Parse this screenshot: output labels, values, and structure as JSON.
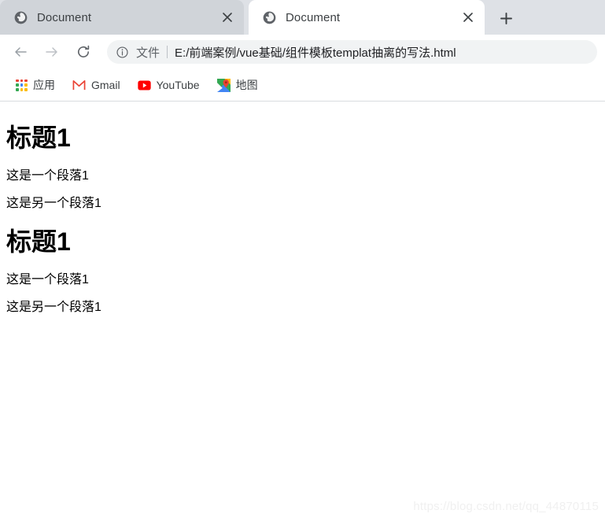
{
  "browser": {
    "tabs": [
      {
        "title": "Document",
        "favicon": "globe-icon",
        "close_label": "×",
        "active": false
      },
      {
        "title": "Document",
        "favicon": "globe-icon",
        "close_label": "×",
        "active": true
      }
    ],
    "new_tab_label": "+",
    "toolbar": {
      "back_label": "←",
      "forward_label": "→",
      "reload_label": "⟳",
      "security_icon": "info-circle-icon",
      "url_scheme": "文件",
      "url_divider": "|",
      "url": "E:/前端案例/vue基础/组件模板templat抽离的写法.html"
    },
    "bookmarks": [
      {
        "label": "应用",
        "icon": "apps-grid-icon"
      },
      {
        "label": "Gmail",
        "icon": "gmail-icon"
      },
      {
        "label": "YouTube",
        "icon": "youtube-icon"
      },
      {
        "label": "地图",
        "icon": "google-maps-icon"
      }
    ]
  },
  "page": {
    "blocks": [
      {
        "heading": "标题1",
        "paragraph1": "这是一个段落1",
        "paragraph2": "这是另一个段落1"
      },
      {
        "heading": "标题1",
        "paragraph1": "这是一个段落1",
        "paragraph2": "这是另一个段落1"
      }
    ],
    "watermark": "https://blog.csdn.net/qq_44870115"
  },
  "colors": {
    "tabstrip_bg": "#dee1e6",
    "inactive_tab_bg": "#d0d4d9",
    "active_tab_bg": "#ffffff",
    "omnibox_bg": "#f1f3f4",
    "text_primary": "#202124",
    "text_secondary": "#5f6368",
    "gmail_red": "#ea4335",
    "youtube_red": "#ff0000",
    "watermark_gray": "#f0f0f0"
  }
}
